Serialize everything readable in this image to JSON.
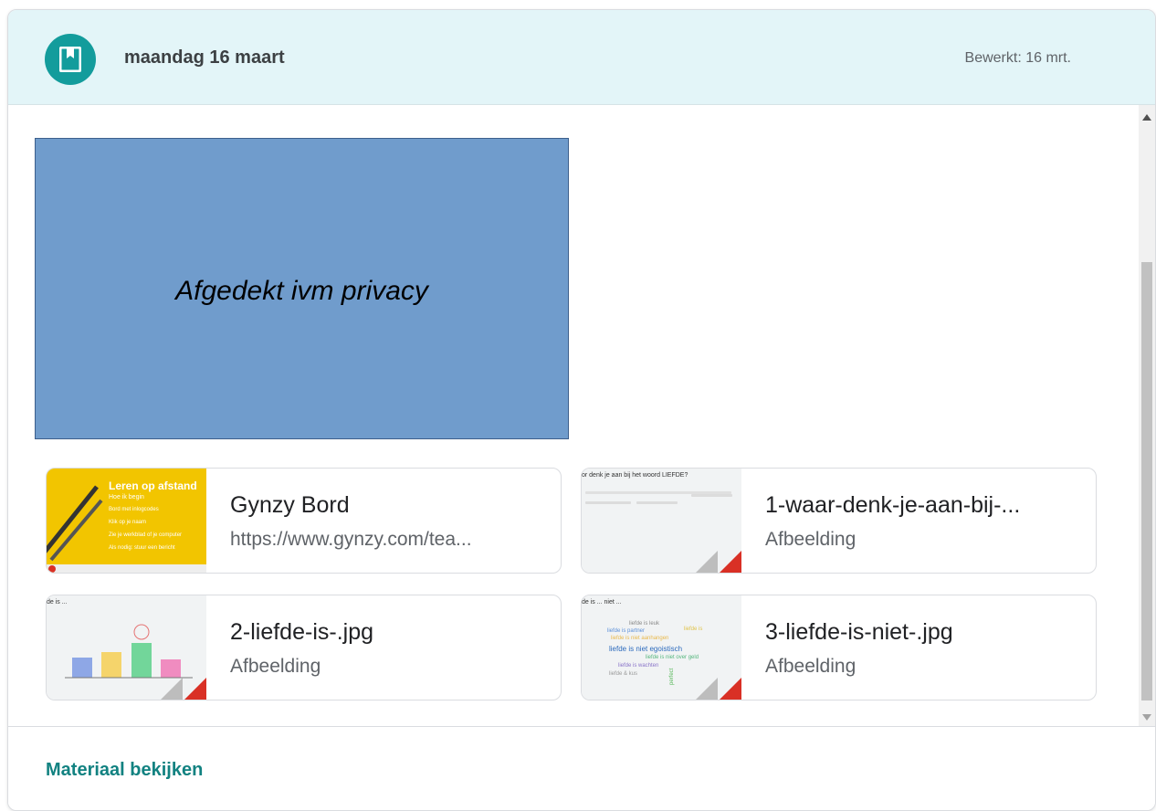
{
  "header": {
    "title": "maandag 16 maart",
    "edited": "Bewerkt: 16 mrt.",
    "icon": "bookmark-icon"
  },
  "privacy_cover": {
    "text": "Afgedekt ivm privacy"
  },
  "attachments": [
    {
      "name": "Gynzy Bord",
      "subtitle": "https://www.gynzy.com/tea...",
      "thumb": {
        "title": "Leren op afstand",
        "subtitle": "Hoe ik begin",
        "rows": [
          "Bord met inlogcodes",
          "Klik op je naam",
          "Zie je werkblad of je computer",
          "Als nodig: stuur een bericht"
        ]
      }
    },
    {
      "name": "1-waar-denk-je-aan-bij-...",
      "subtitle": "Afbeelding",
      "thumb": {
        "title": "or denk je aan bij het woord LIEFDE?"
      }
    },
    {
      "name": "2-liefde-is-.jpg",
      "subtitle": "Afbeelding",
      "thumb": {
        "title": "de is ..."
      }
    },
    {
      "name": "3-liefde-is-niet-.jpg",
      "subtitle": "Afbeelding",
      "thumb": {
        "title": "de is ... niet ...",
        "words": [
          "liefde is leuk",
          "liefde is partner",
          "liefde is niet aanhangen",
          "liefde is niet egoistisch",
          "liefde is niet over geld",
          "liefde is wachten",
          "liefde & kus",
          "perfect",
          "liefde is"
        ]
      }
    }
  ],
  "footer": {
    "link": "Materiaal bekijken"
  },
  "colors": {
    "header_bg": "#e3f5f8",
    "accent": "#139c9c",
    "link": "#128281",
    "privacy_cover": "#709ccc"
  }
}
